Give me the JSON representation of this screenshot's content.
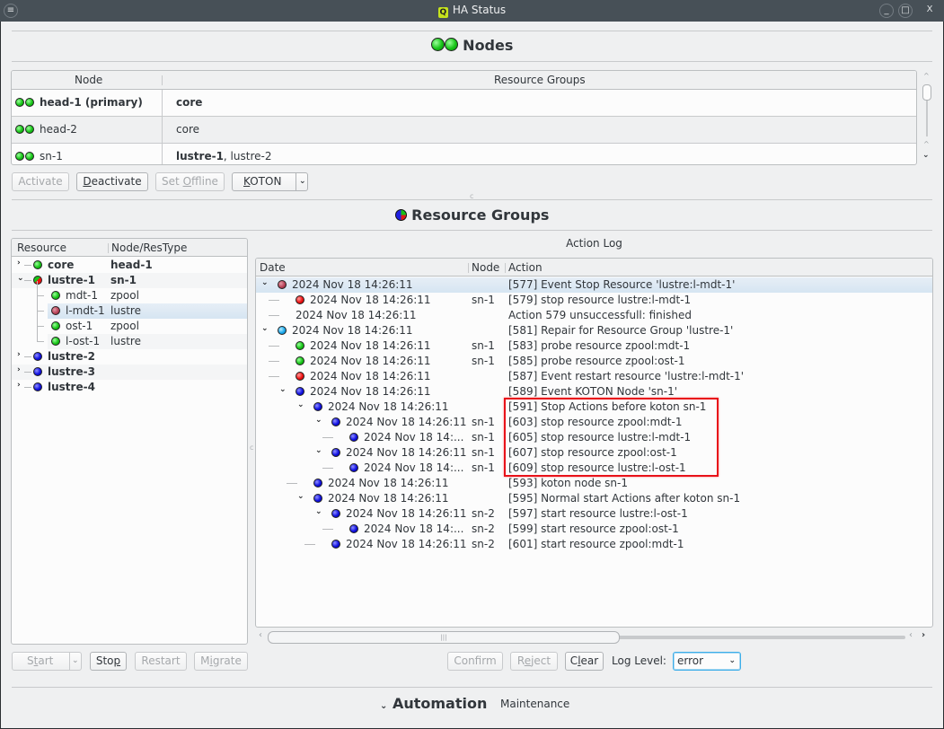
{
  "window": {
    "title": "HA Status",
    "app_icon": "Q",
    "menu_icon": "menu-icon",
    "controls": [
      "minimize",
      "maximize",
      "close"
    ]
  },
  "nodes_section": {
    "title": "Nodes",
    "columns": [
      "Node",
      "Resource Groups"
    ],
    "rows": [
      {
        "node": "head-1 (primary)",
        "node_bold": true,
        "groups_bold": "core",
        "groups_rest": "",
        "status": [
          "green",
          "green"
        ]
      },
      {
        "node": "head-2",
        "node_bold": false,
        "groups_bold": "",
        "groups_rest": "core",
        "status": [
          "green",
          "green"
        ]
      },
      {
        "node": "sn-1",
        "node_bold": false,
        "groups_bold": "lustre-1",
        "groups_rest": ", lustre-2",
        "status": [
          "green",
          "green"
        ]
      }
    ],
    "buttons": {
      "activate": "Activate",
      "deactivate": "Deactivate",
      "set_offline": "Set Offline",
      "koton": "KOTON"
    }
  },
  "resource_groups_section": {
    "title": "Resource Groups",
    "tree_columns": [
      "Resource",
      "Node/ResType"
    ],
    "tree": [
      {
        "name": "core",
        "type": "head-1",
        "status": "green",
        "level": 0,
        "expander": "collapsed",
        "bold": true
      },
      {
        "name": "lustre-1",
        "type": "sn-1",
        "status": "split",
        "level": 0,
        "expander": "expanded",
        "bold": true
      },
      {
        "name": "mdt-1",
        "type": "zpool",
        "status": "green",
        "level": 1,
        "expander": "",
        "bold": false
      },
      {
        "name": "l-mdt-1",
        "type": "lustre",
        "status": "maroon",
        "level": 1,
        "expander": "",
        "bold": false,
        "selected": true
      },
      {
        "name": "ost-1",
        "type": "zpool",
        "status": "green",
        "level": 1,
        "expander": "",
        "bold": false
      },
      {
        "name": "l-ost-1",
        "type": "lustre",
        "status": "green",
        "level": 1,
        "expander": "",
        "bold": false
      },
      {
        "name": "lustre-2",
        "type": "",
        "status": "blue",
        "level": 0,
        "expander": "collapsed",
        "bold": true
      },
      {
        "name": "lustre-3",
        "type": "",
        "status": "blue",
        "level": 0,
        "expander": "collapsed",
        "bold": true
      },
      {
        "name": "lustre-4",
        "type": "",
        "status": "blue",
        "level": 0,
        "expander": "collapsed",
        "bold": true
      }
    ],
    "tree_buttons": {
      "start": "Start",
      "stop": "Stop",
      "restart": "Restart",
      "migrate": "Migrate"
    },
    "action_log": {
      "title": "Action Log",
      "columns": [
        "Date",
        "Node",
        "Action"
      ],
      "rows": [
        {
          "level": 0,
          "expander": "expanded",
          "status": "maroon",
          "date": "2024 Nov 18 14:26:11",
          "node": "",
          "action": "[577] Event Stop Resource 'lustre:l-mdt-1'",
          "selected": true
        },
        {
          "level": 1,
          "expander": "",
          "status": "red",
          "date": "2024 Nov 18 14:26:11",
          "node": "sn-1",
          "action": "[579] stop resource lustre:l-mdt-1"
        },
        {
          "level": 1,
          "expander": "",
          "status": "",
          "date": "2024 Nov 18 14:26:11",
          "node": "",
          "action": "Action 579 unsuccessfull: finished"
        },
        {
          "level": 0,
          "expander": "expanded",
          "status": "cyan",
          "date": "2024 Nov 18 14:26:11",
          "node": "",
          "action": "[581] Repair for Resource Group 'lustre-1'"
        },
        {
          "level": 1,
          "expander": "",
          "status": "green",
          "date": "2024 Nov 18 14:26:11",
          "node": "sn-1",
          "action": "[583] probe resource zpool:mdt-1"
        },
        {
          "level": 1,
          "expander": "",
          "status": "green",
          "date": "2024 Nov 18 14:26:11",
          "node": "sn-1",
          "action": "[585] probe resource zpool:ost-1"
        },
        {
          "level": 1,
          "expander": "",
          "status": "red",
          "date": "2024 Nov 18 14:26:11",
          "node": "",
          "action": "[587] Event restart resource 'lustre:l-mdt-1'"
        },
        {
          "level": 1,
          "expander": "expanded",
          "status": "blue",
          "date": "2024 Nov 18 14:26:11",
          "node": "",
          "action": "[589] Event KOTON Node 'sn-1'"
        },
        {
          "level": 2,
          "expander": "expanded",
          "status": "blue",
          "date": "2024 Nov 18 14:26:11",
          "node": "",
          "action": "[591] Stop Actions before koton sn-1"
        },
        {
          "level": 3,
          "expander": "expanded",
          "status": "blue",
          "date": "2024 Nov 18 14:26:11",
          "node": "sn-1",
          "action": "[603] stop resource zpool:mdt-1"
        },
        {
          "level": 4,
          "expander": "",
          "status": "blue",
          "date": "2024 Nov 18 14:...",
          "node": "sn-1",
          "action": "[605] stop resource lustre:l-mdt-1"
        },
        {
          "level": 3,
          "expander": "expanded",
          "status": "blue",
          "date": "2024 Nov 18 14:26:11",
          "node": "sn-1",
          "action": "[607] stop resource zpool:ost-1"
        },
        {
          "level": 4,
          "expander": "",
          "status": "blue",
          "date": "2024 Nov 18 14:...",
          "node": "sn-1",
          "action": "[609] stop resource lustre:l-ost-1"
        },
        {
          "level": 2,
          "expander": "",
          "status": "blue",
          "date": "2024 Nov 18 14:26:11",
          "node": "",
          "action": "[593] koton node sn-1"
        },
        {
          "level": 2,
          "expander": "expanded",
          "status": "blue",
          "date": "2024 Nov 18 14:26:11",
          "node": "",
          "action": "[595] Normal start Actions after koton sn-1"
        },
        {
          "level": 3,
          "expander": "expanded",
          "status": "blue",
          "date": "2024 Nov 18 14:26:11",
          "node": "sn-2",
          "action": "[597] start resource lustre:l-ost-1"
        },
        {
          "level": 4,
          "expander": "",
          "status": "blue",
          "date": "2024 Nov 18 14:...",
          "node": "sn-2",
          "action": "[599] start resource zpool:ost-1"
        },
        {
          "level": 3,
          "expander": "",
          "status": "blue",
          "date": "2024 Nov 18 14:26:11",
          "node": "sn-2",
          "action": "[601] start resource zpool:mdt-1"
        }
      ],
      "buttons": {
        "confirm": "Confirm",
        "reject": "Reject",
        "clear": "Clear"
      },
      "log_level_label": "Log Level:",
      "log_level_value": "error"
    }
  },
  "bottom_tabs": {
    "automation": "Automation",
    "maintenance": "Maintenance"
  },
  "colors": {
    "highlight_box": "#e8121a",
    "selection": "#d6e5f2",
    "focus": "#3daee9"
  }
}
